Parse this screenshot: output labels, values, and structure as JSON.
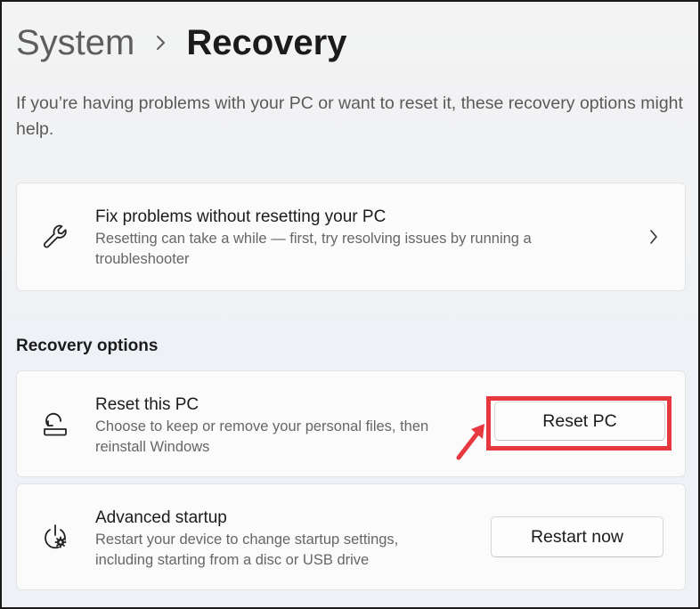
{
  "breadcrumb": {
    "parent": "System",
    "current": "Recovery"
  },
  "intro": "If you’re having problems with your PC or want to reset it, these recovery options might help.",
  "fix_card": {
    "title": "Fix problems without resetting your PC",
    "description": "Resetting can take a while — first, try resolving issues by running a troubleshooter",
    "icon": "wrench-icon"
  },
  "recovery_options": {
    "heading": "Recovery options",
    "reset": {
      "title": "Reset this PC",
      "description": "Choose to keep or remove your personal files, then reinstall Windows",
      "button": "Reset PC",
      "icon": "reset-pc-icon"
    },
    "advanced": {
      "title": "Advanced startup",
      "description": "Restart your device to change startup settings, including starting from a disc or USB drive",
      "button": "Restart now",
      "icon": "power-settings-icon"
    }
  },
  "annotation": {
    "highlight_color": "#e8383f"
  }
}
